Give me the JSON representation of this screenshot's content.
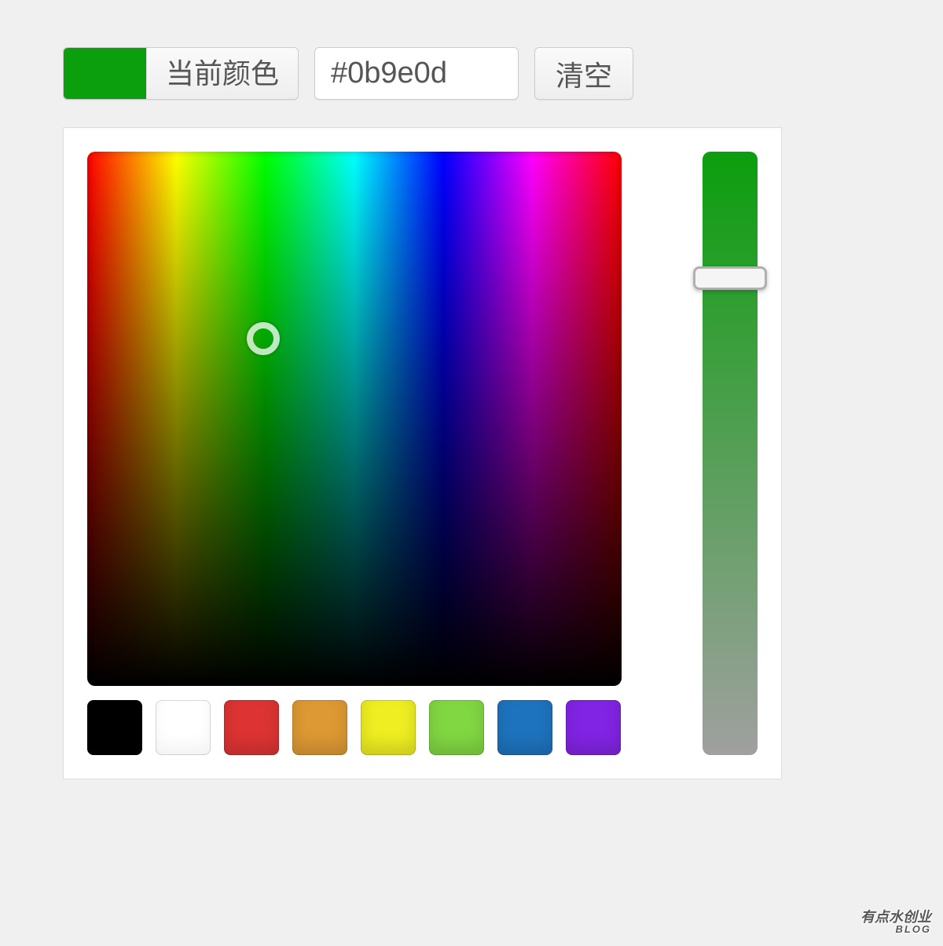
{
  "toolbar": {
    "current_color_label": "当前颜色",
    "current_color_value": "#0b9e0d",
    "hex_value": "#0b9e0d",
    "clear_label": "清空"
  },
  "picker": {
    "selected_hue_percent": 33,
    "selected_value_percent": 35,
    "slider_position_percent": 19,
    "slider_gradient_start": "#0b9e0d",
    "slider_gradient_end": "#a0a0a0"
  },
  "swatches": [
    {
      "color": "#000000",
      "name": "black"
    },
    {
      "color": "#ffffff",
      "name": "white"
    },
    {
      "color": "#dd3333",
      "name": "red"
    },
    {
      "color": "#dd9933",
      "name": "orange"
    },
    {
      "color": "#eeee22",
      "name": "yellow"
    },
    {
      "color": "#81d742",
      "name": "green"
    },
    {
      "color": "#1e73be",
      "name": "blue"
    },
    {
      "color": "#8224e3",
      "name": "purple"
    }
  ],
  "watermark": {
    "line1": "有点水创业",
    "line2": "BLOG"
  }
}
